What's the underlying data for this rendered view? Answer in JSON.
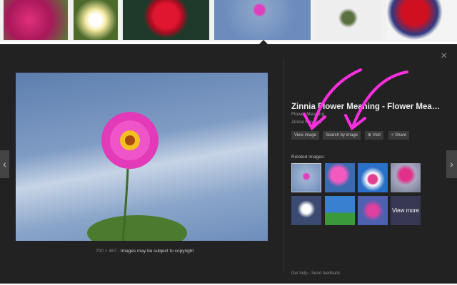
{
  "thumbnails": [
    {
      "alt": "zinnia bouquet"
    },
    {
      "alt": "white plumeria"
    },
    {
      "alt": "red dahlia"
    },
    {
      "alt": "pink zinnia sky",
      "selected": true
    },
    {
      "alt": "beetle"
    },
    {
      "alt": "rose vase"
    }
  ],
  "viewer": {
    "caption_size": "700 × 467",
    "caption_sep": " - ",
    "caption_note": "Images may be subject to copyright",
    "title": "Zinnia Flower Meaning - Flower Mea…",
    "site": "Flower Meaning",
    "subtitle": "Zinnia Flowers",
    "buttons": {
      "view": "View image",
      "search": "Search by image",
      "visit": "Visit",
      "share": "Share"
    },
    "related_label": "Related images:",
    "view_more": "View more",
    "footer_help": "Get help",
    "footer_sep": " - ",
    "footer_feedback": "Send feedback",
    "prev": "‹",
    "next": "›",
    "close": "×"
  },
  "colors": {
    "panel": "#222222",
    "annotation": "#ff2ee0"
  }
}
